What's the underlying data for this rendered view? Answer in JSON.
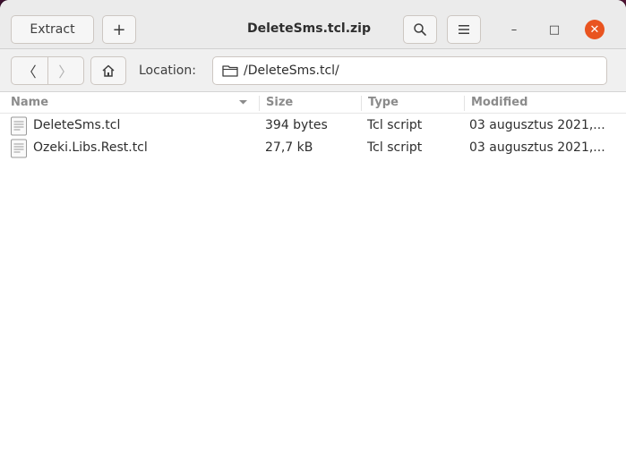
{
  "window": {
    "title": "DeleteSms.tcl.zip"
  },
  "headerbar": {
    "extract_label": "Extract",
    "add_label": "+",
    "search_icon": "search-icon",
    "menu_icon": "hamburger-menu-icon",
    "minimize_glyph": "–",
    "maximize_glyph": "□",
    "close_glyph": "✕"
  },
  "toolbar": {
    "back_glyph": "〈",
    "forward_glyph": "〉",
    "location_label": "Location:",
    "location_value": "/DeleteSms.tcl/"
  },
  "columns": [
    {
      "label": "Name"
    },
    {
      "label": "Size"
    },
    {
      "label": "Type"
    },
    {
      "label": "Modified"
    }
  ],
  "files": [
    {
      "name": "DeleteSms.tcl",
      "size": "394 bytes",
      "type": "Tcl script",
      "modified": "03 augusztus 2021,..."
    },
    {
      "name": "Ozeki.Libs.Rest.tcl",
      "size": "27,7 kB",
      "type": "Tcl script",
      "modified": "03 augusztus 2021,..."
    }
  ],
  "colors": {
    "accent_close": "#e95420",
    "headerbar_bg": "#ebebeb",
    "desktop_bg": "#5a1538"
  }
}
